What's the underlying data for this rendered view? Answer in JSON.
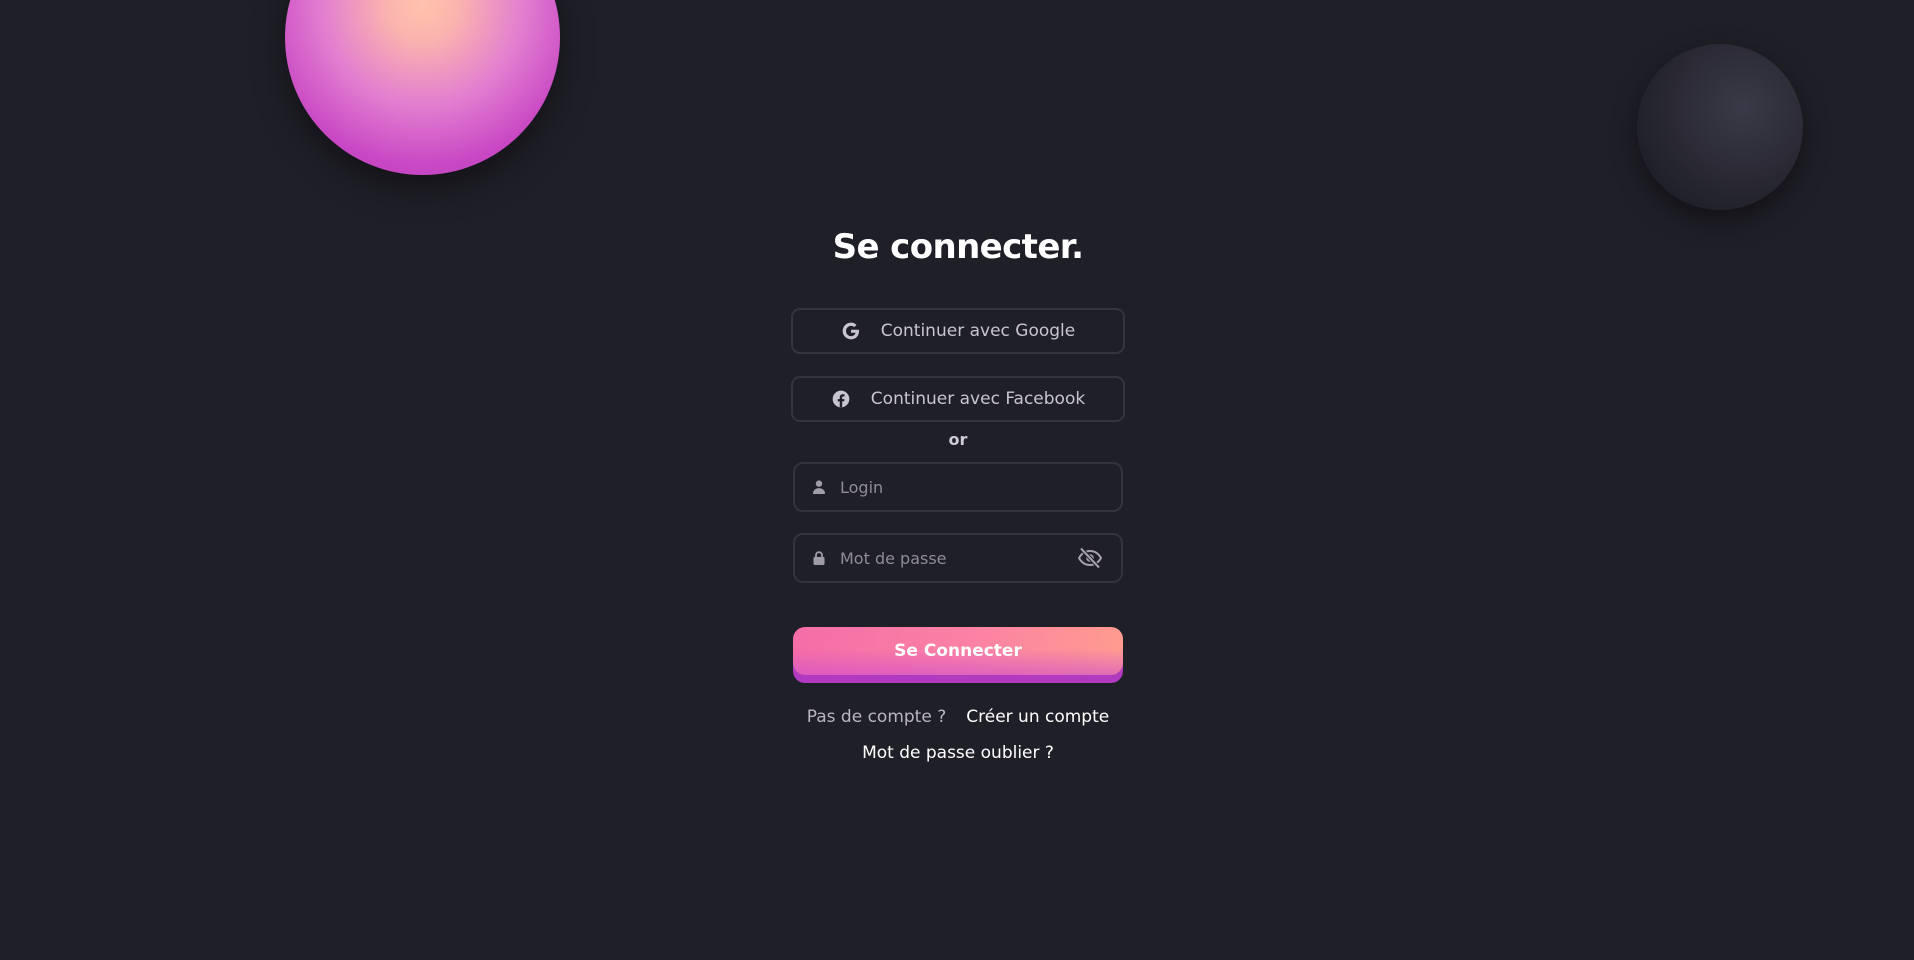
{
  "login": {
    "title": "Se connecter.",
    "social": {
      "google_label": "Continuer avec Google",
      "facebook_label": "Continuer avec Facebook"
    },
    "separator": "or",
    "fields": {
      "login_placeholder": "Login",
      "password_placeholder": "Mot de passe"
    },
    "submit_label": "Se Connecter",
    "no_account_text": "Pas de compte ?",
    "create_account_link": "Créer un compte",
    "forgot_password_link": "Mot de passe oublier ?"
  },
  "icons": {
    "google": "google-icon",
    "facebook": "facebook-icon",
    "user": "user-icon",
    "lock": "lock-icon",
    "eye": "eye-slash-icon"
  },
  "colors": {
    "background": "#1f1f27",
    "border": "#34343f",
    "accent_start": "#f56da7",
    "accent_end": "#ff9b8f",
    "accent_shadow": "#b23ac0",
    "text_primary": "#ffffff",
    "text_muted": "#b9b6bf"
  }
}
